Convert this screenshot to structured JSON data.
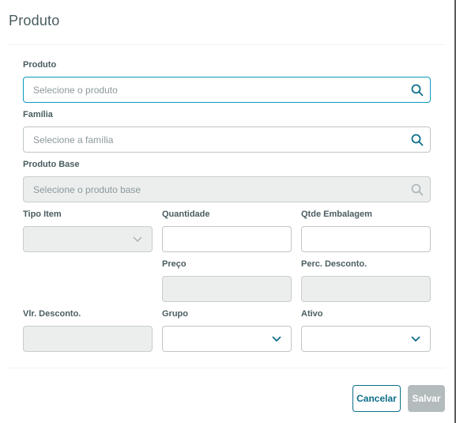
{
  "dialog": {
    "title": "Produto"
  },
  "fields": {
    "produto": {
      "label": "Produto",
      "placeholder": "Selecione o produto"
    },
    "familia": {
      "label": "Família",
      "placeholder": "Selecione a família"
    },
    "produto_base": {
      "label": "Produto Base",
      "placeholder": "Selecione o produto base"
    },
    "tipo_item": {
      "label": "Tipo Item",
      "value": ""
    },
    "quantidade": {
      "label": "Quantidade",
      "value": ""
    },
    "qtde_embalagem": {
      "label": "Qtde Embalagem",
      "value": ""
    },
    "preco": {
      "label": "Preço",
      "value": ""
    },
    "perc_desconto": {
      "label": "Perc. Desconto.",
      "value": ""
    },
    "vlr_desconto": {
      "label": "Vlr. Desconto.",
      "value": ""
    },
    "grupo": {
      "label": "Grupo",
      "value": ""
    },
    "ativo": {
      "label": "Ativo",
      "value": ""
    }
  },
  "actions": {
    "cancel_label": "Cancelar",
    "save_label": "Salvar"
  },
  "colors": {
    "accent": "#0c9abe",
    "disabled_bg": "#eceeee",
    "save_disabled": "#b3bbbd"
  },
  "icons": {
    "lookup": "search-icon",
    "select": "chevron-down-icon"
  }
}
